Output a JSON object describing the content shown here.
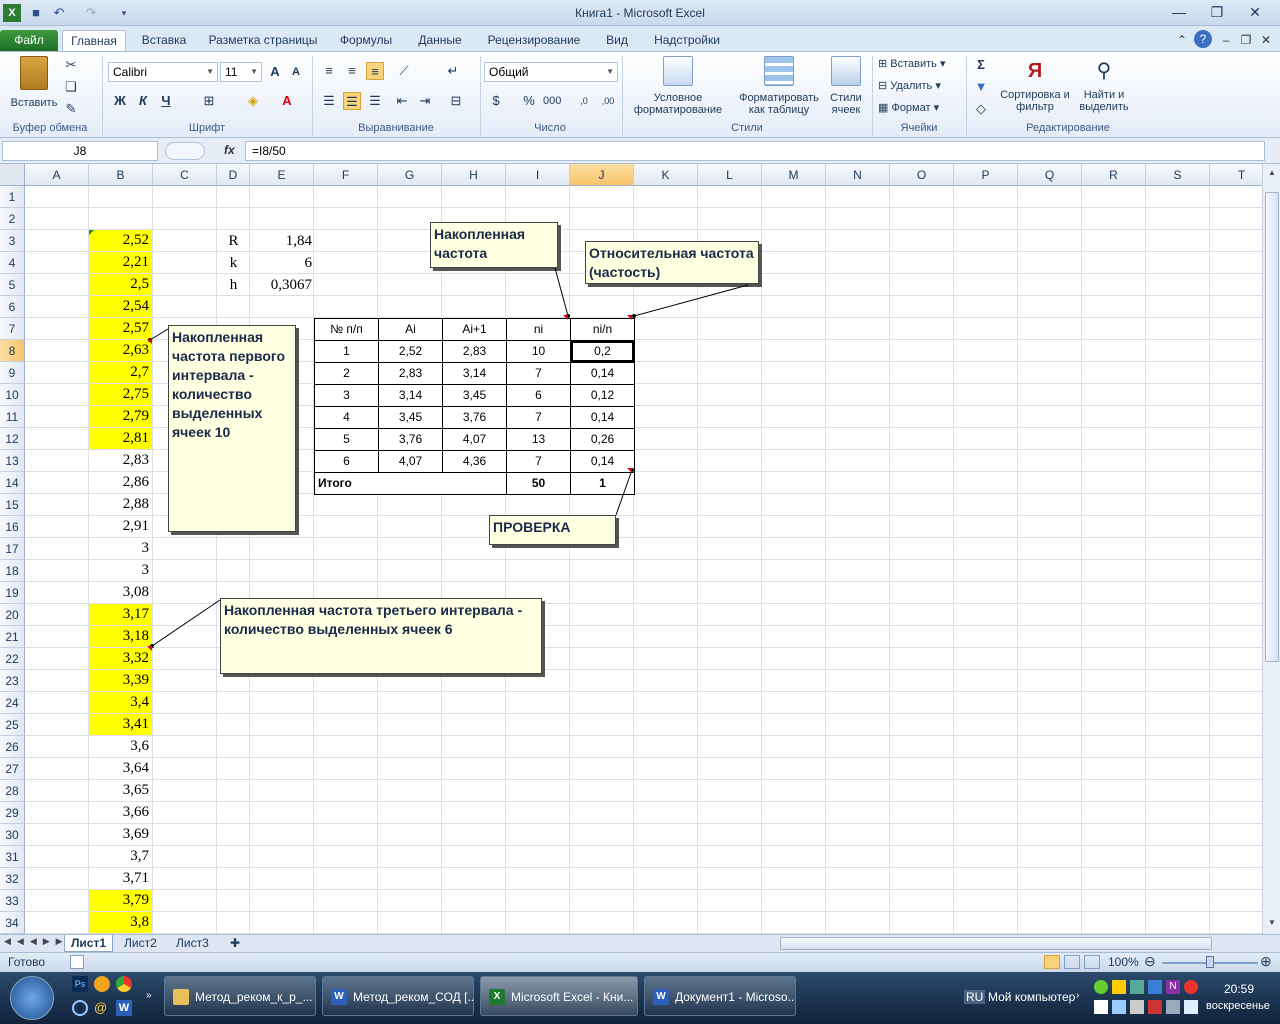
{
  "window": {
    "title": "Книга1  -  Microsoft Excel"
  },
  "tabs": [
    "Файл",
    "Главная",
    "Вставка",
    "Разметка страницы",
    "Формулы",
    "Данные",
    "Рецензирование",
    "Вид",
    "Надстройки"
  ],
  "ribbon": {
    "paste": "Вставить",
    "clipboard_label": "Буфер обмена",
    "font_name": "Calibri",
    "font_size": "11",
    "font_label": "Шрифт",
    "bold": "Ж",
    "italic": "К",
    "underline": "Ч",
    "align_label": "Выравнивание",
    "number_format": "Общий",
    "number_label": "Число",
    "cond_format": "Условное форматирование",
    "format_table": "Форматировать как таблицу",
    "cell_styles": "Стили ячеек",
    "styles_label": "Стили",
    "insert": "Вставить",
    "delete": "Удалить",
    "format": "Формат",
    "cells_label": "Ячейки",
    "sort": "Сортировка и фильтр",
    "find": "Найти и выделить",
    "edit_label": "Редактирование"
  },
  "formula_bar": {
    "name_box": "J8",
    "fx": "fx",
    "formula": "=I8/50"
  },
  "columns": [
    "A",
    "B",
    "C",
    "D",
    "E",
    "F",
    "G",
    "H",
    "I",
    "J",
    "K",
    "L",
    "M",
    "N",
    "O",
    "P",
    "Q",
    "R",
    "S",
    "T"
  ],
  "rows": [
    "1",
    "2",
    "3",
    "4",
    "5",
    "6",
    "7",
    "8",
    "9",
    "10",
    "11",
    "12",
    "13",
    "14",
    "15",
    "16",
    "17",
    "18",
    "19",
    "20",
    "21",
    "22",
    "23",
    "24",
    "25",
    "26",
    "27",
    "28",
    "29",
    "30",
    "31",
    "32",
    "33",
    "34"
  ],
  "col_b_values": [
    "",
    "",
    "2,52",
    "2,21",
    "2,5",
    "2,54",
    "2,57",
    "2,63",
    "2,7",
    "2,75",
    "2,79",
    "2,81",
    "2,83",
    "2,86",
    "2,88",
    "2,91",
    "3",
    "3",
    "3,08",
    "3,17",
    "3,18",
    "3,32",
    "3,39",
    "3,4",
    "3,41",
    "3,6",
    "3,64",
    "3,65",
    "3,66",
    "3,69",
    "3,7",
    "3,71",
    "3,79",
    "3,8"
  ],
  "params": [
    {
      "label": "R",
      "value": "1,84"
    },
    {
      "label": "k",
      "value": "6"
    },
    {
      "label": "h",
      "value": "0,3067"
    }
  ],
  "table": {
    "headers": [
      "№ п/п",
      "Ai",
      "Ai+1",
      "ni",
      "ni/n"
    ],
    "rows": [
      [
        "1",
        "2,52",
        "2,83",
        "10",
        "0,2"
      ],
      [
        "2",
        "2,83",
        "3,14",
        "7",
        "0,14"
      ],
      [
        "3",
        "3,14",
        "3,45",
        "6",
        "0,12"
      ],
      [
        "4",
        "3,45",
        "3,76",
        "7",
        "0,14"
      ],
      [
        "5",
        "3,76",
        "4,07",
        "13",
        "0,26"
      ],
      [
        "6",
        "4,07",
        "4,36",
        "7",
        "0,14"
      ]
    ],
    "total_label": "Итого",
    "total_ni": "50",
    "total_rel": "1"
  },
  "comments": {
    "cumulative": "Накопленная частота",
    "relative": "Относительная частота (частость)",
    "first_interval": "Накопленная частота первого интервала - количество выделенных ячеек 10",
    "check": "ПРОВЕРКА",
    "third_interval": "Накопленная частота третьего интервала - количество выделенных ячеек 6"
  },
  "sheets": [
    "Лист1",
    "Лист2",
    "Лист3"
  ],
  "status": {
    "ready": "Готово",
    "zoom": "100%"
  },
  "taskbar": {
    "items": [
      "Метод_реком_к_р_...",
      "Метод_реком_СОД [...",
      "Microsoft Excel - Кни...",
      "Документ1 - Microso..."
    ],
    "lang": "RU",
    "my_computer": "Мой компьютер",
    "time": "20:59",
    "day": "воскресенье"
  }
}
